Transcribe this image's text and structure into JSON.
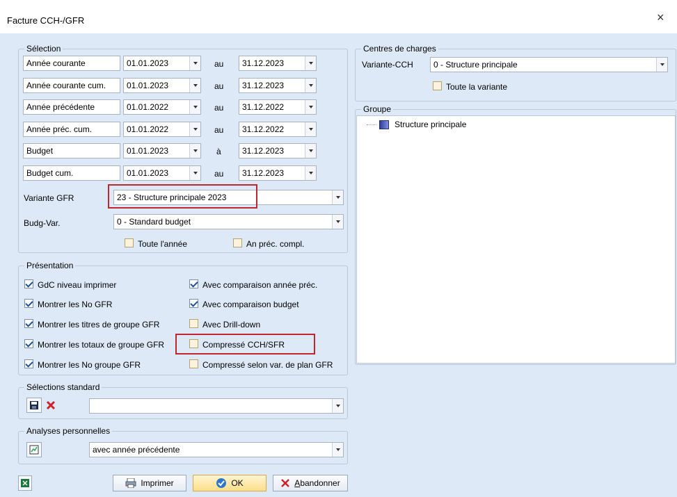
{
  "window": {
    "title": "Facture CCH-/GFR",
    "close_glyph": "×"
  },
  "selection": {
    "group_label": "Sélection",
    "rows": [
      {
        "label": "Année courante",
        "from": "01.01.2023",
        "sep": "au",
        "to": "31.12.2023"
      },
      {
        "label": "Année courante cum.",
        "from": "01.01.2023",
        "sep": "au",
        "to": "31.12.2023"
      },
      {
        "label": "Année précédente",
        "from": "01.01.2022",
        "sep": "au",
        "to": "31.12.2022"
      },
      {
        "label": "Année préc. cum.",
        "from": "01.01.2022",
        "sep": "au",
        "to": "31.12.2022"
      },
      {
        "label": "Budget",
        "from": "01.01.2023",
        "sep": "à",
        "to": "31.12.2023"
      },
      {
        "label": "Budget cum.",
        "from": "01.01.2023",
        "sep": "au",
        "to": "31.12.2023"
      }
    ],
    "variante_gfr_label": "Variante GFR",
    "variante_gfr_value": "23 - Structure principale 2023",
    "budg_var_label": "Budg-Var.",
    "budg_var_value": "0 - Standard budget",
    "toute_annee": "Toute l'année",
    "an_prec_compl": "An préc. compl."
  },
  "presentation": {
    "group_label": "Présentation",
    "left": [
      {
        "label": "GdC niveau imprimer",
        "checked": true
      },
      {
        "label": "Montrer les No GFR",
        "checked": true
      },
      {
        "label": "Montrer les titres de groupe GFR",
        "checked": true
      },
      {
        "label": "Montrer les totaux de groupe GFR",
        "checked": true
      },
      {
        "label": "Montrer les No groupe GFR",
        "checked": true
      }
    ],
    "right": [
      {
        "label": "Avec comparaison année préc.",
        "checked": true
      },
      {
        "label": "Avec comparaison budget",
        "checked": true
      },
      {
        "label": "Avec Drill-down",
        "checked": false
      },
      {
        "label": "Compressé CCH/SFR",
        "checked": false
      },
      {
        "label": "Compressé selon var. de plan GFR",
        "checked": false
      }
    ]
  },
  "standard": {
    "group_label": "Sélections standard",
    "value": ""
  },
  "analyses": {
    "group_label": "Analyses personnelles",
    "value": "avec année précédente"
  },
  "centres": {
    "group_label": "Centres de charges",
    "variante_label": "Variante-CCH",
    "variante_value": "0 - Structure principale",
    "toute_variante": "Toute la variante"
  },
  "groupe": {
    "group_label": "Groupe",
    "tree_item": "Structure principale"
  },
  "buttons": {
    "print": "Imprimer",
    "ok": "OK",
    "cancel_first": "A",
    "cancel_rest": "bandonner"
  }
}
